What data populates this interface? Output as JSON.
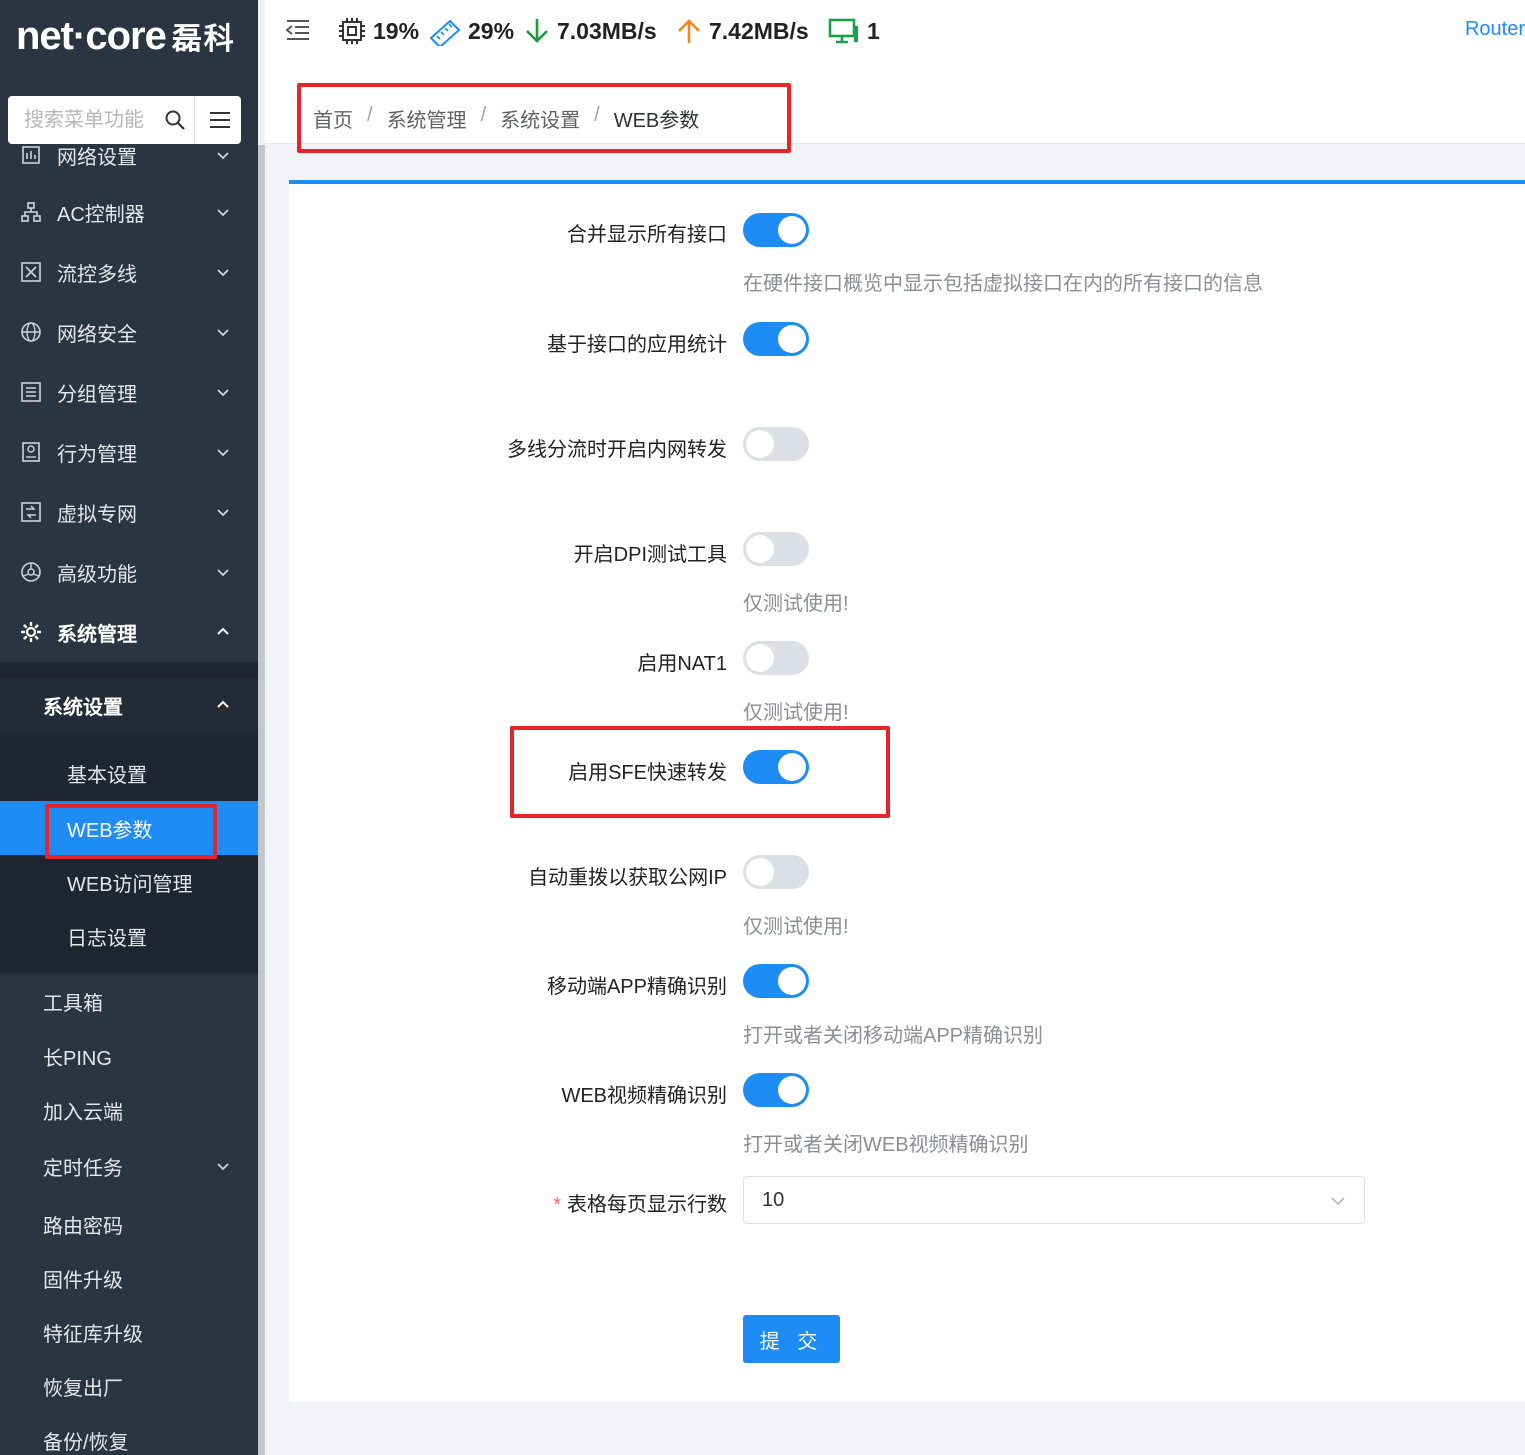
{
  "brand": {
    "logo_text": "net·core",
    "logo_cn": "磊科"
  },
  "search": {
    "placeholder": "搜索菜单功能"
  },
  "header": {
    "cpu": "19%",
    "memory": "29%",
    "download": "7.03MB/s",
    "upload": "7.42MB/s",
    "clients": "1",
    "router_link": "Router",
    "colors": {
      "down": "#1a9a3a",
      "up": "#f08a1c",
      "client": "#18a34a"
    }
  },
  "breadcrumb": [
    "首页",
    "系统管理",
    "系统设置",
    "WEB参数"
  ],
  "sidebar": {
    "items": [
      {
        "label": "网络设置",
        "icon": "network-icon"
      },
      {
        "label": "AC控制器",
        "icon": "topology-icon"
      },
      {
        "label": "流控多线",
        "icon": "flow-icon"
      },
      {
        "label": "网络安全",
        "icon": "globe-icon"
      },
      {
        "label": "分组管理",
        "icon": "list-icon"
      },
      {
        "label": "行为管理",
        "icon": "behavior-icon"
      },
      {
        "label": "虚拟专网",
        "icon": "vpn-icon"
      },
      {
        "label": "高级功能",
        "icon": "advanced-icon"
      },
      {
        "label": "系统管理",
        "icon": "gear-icon"
      }
    ],
    "sub_header": "系统设置",
    "sub_items": [
      "基本设置",
      "WEB参数",
      "WEB访问管理",
      "日志设置"
    ],
    "tools": [
      "工具箱",
      "长PING",
      "加入云端",
      "定时任务",
      "路由密码",
      "固件升级",
      "特征库升级",
      "恢复出厂",
      "备份/恢复"
    ]
  },
  "form": {
    "rows": [
      {
        "label": "合并显示所有接口",
        "on": true,
        "hint": "在硬件接口概览中显示包括虚拟接口在内的所有接口的信息"
      },
      {
        "label": "基于接口的应用统计",
        "on": true,
        "hint": ""
      },
      {
        "label": "多线分流时开启内网转发",
        "on": false,
        "hint": ""
      },
      {
        "label": "开启DPI测试工具",
        "on": false,
        "hint": "仅测试使用!"
      },
      {
        "label": "启用NAT1",
        "on": false,
        "hint": "仅测试使用!"
      },
      {
        "label": "启用SFE快速转发",
        "on": true,
        "hint": ""
      },
      {
        "label": "自动重拨以获取公网IP",
        "on": false,
        "hint": "仅测试使用!"
      },
      {
        "label": "移动端APP精确识别",
        "on": true,
        "hint": "打开或者关闭移动端APP精确识别"
      },
      {
        "label": "WEB视频精确识别",
        "on": true,
        "hint": "打开或者关闭WEB视频精确识别"
      }
    ],
    "rows_per_page_label": "表格每页显示行数",
    "rows_per_page_value": "10",
    "required_mark": "*",
    "submit_label": "提 交"
  },
  "accent_color": "#1e8cf5",
  "highlight_color": "#e8242b"
}
